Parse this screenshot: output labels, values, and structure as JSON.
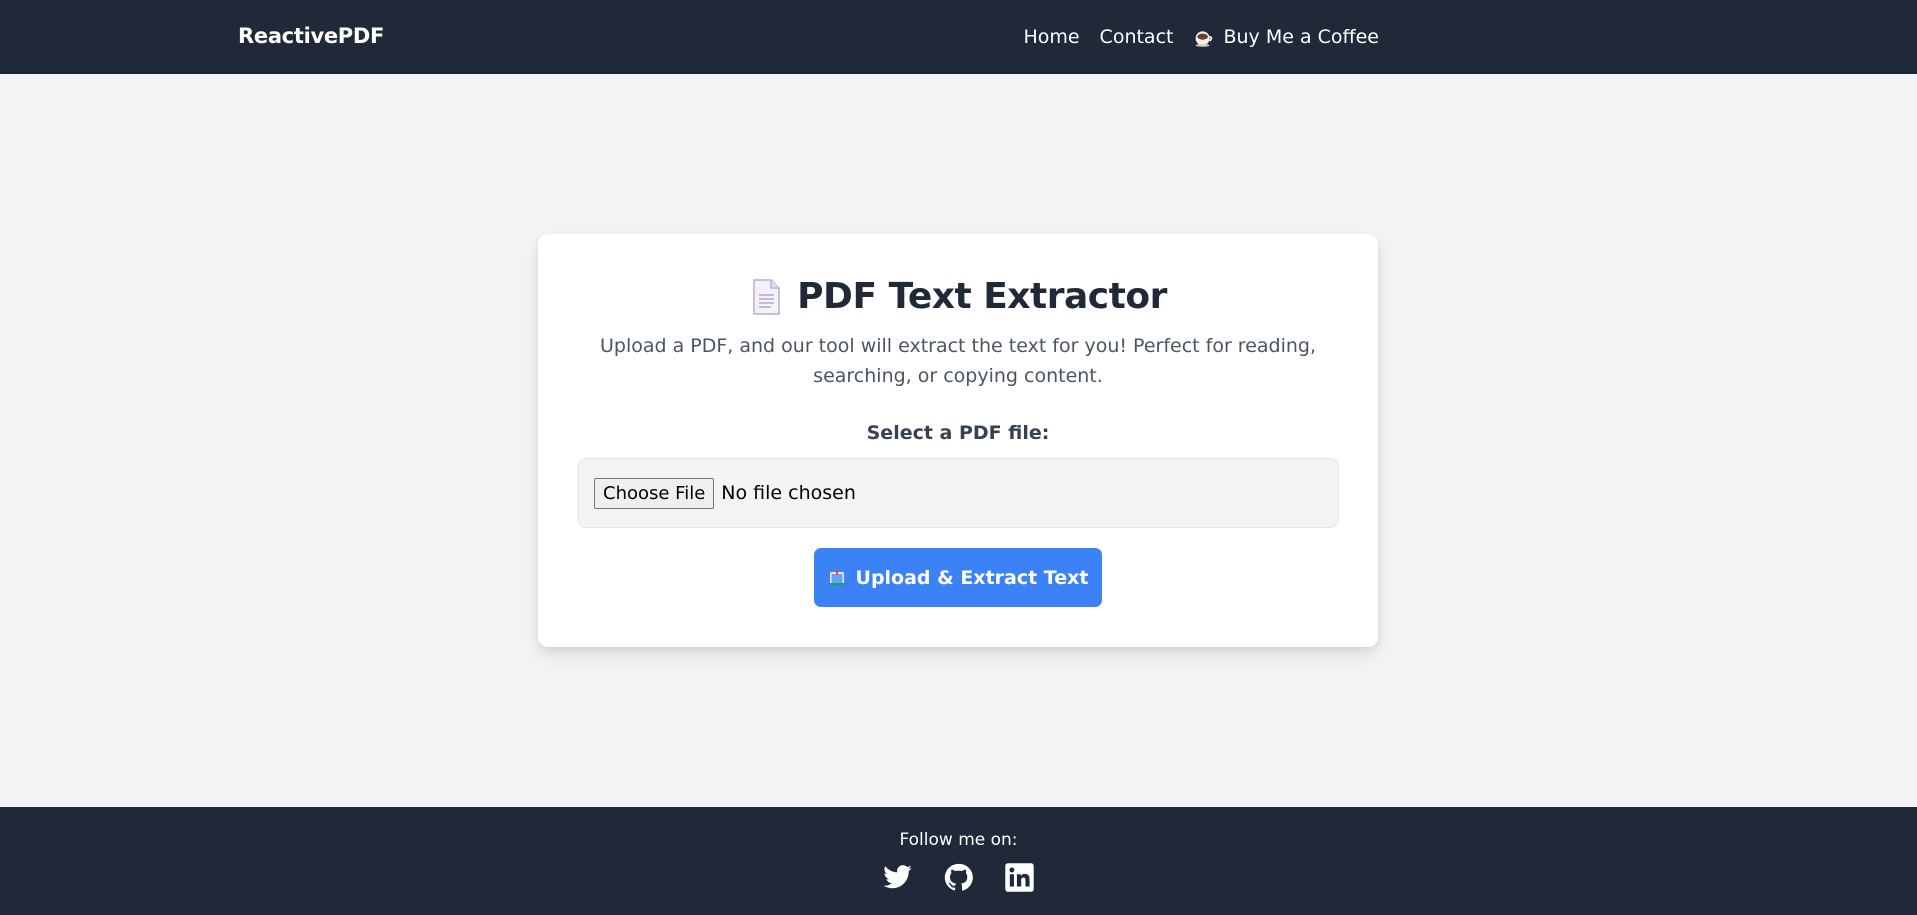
{
  "header": {
    "brand": "ReactivePDF",
    "nav": [
      {
        "label": "Home"
      },
      {
        "label": "Contact"
      },
      {
        "label": "Buy Me a Coffee",
        "icon": "coffee-icon"
      }
    ]
  },
  "card": {
    "icon": "document-icon",
    "title": "PDF Text Extractor",
    "description": "Upload a PDF, and our tool will extract the text for you! Perfect for reading, searching, or copying content.",
    "field_label": "Select a PDF file:",
    "file_input": {
      "button_label": "Choose File",
      "status": "No file chosen"
    },
    "submit": {
      "label": "Upload & Extract Text",
      "icon": "book-icon"
    }
  },
  "footer": {
    "follow_text": "Follow me on:",
    "socials": [
      "twitter-icon",
      "github-icon",
      "linkedin-icon"
    ]
  },
  "colors": {
    "header_bg": "#1f2937",
    "page_bg": "#f3f4f6",
    "accent": "#3b82f6",
    "title": "#1f2937"
  }
}
